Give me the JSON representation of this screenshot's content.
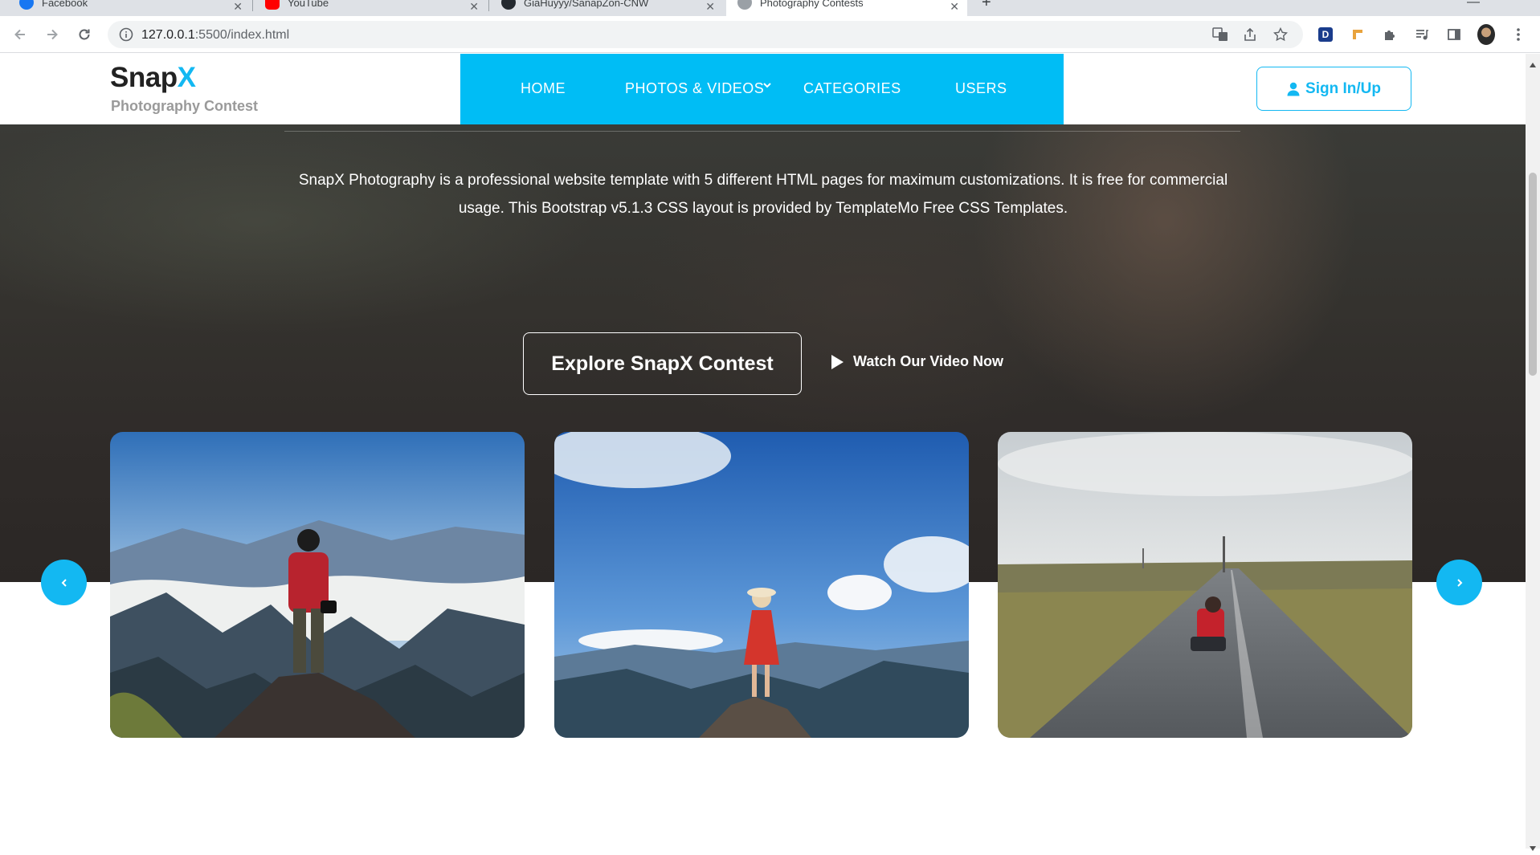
{
  "browser": {
    "tabs": [
      {
        "label": "Facebook",
        "active": false
      },
      {
        "label": "YouTube",
        "active": false
      },
      {
        "label": "GiaHuyyy/SanapZon-CNW",
        "active": false
      },
      {
        "label": "Photography Contests",
        "active": true
      }
    ],
    "url_host": "127.0.0.1",
    "url_rest": ":5500/index.html",
    "profile_badge": "D"
  },
  "site": {
    "logo_main": "Snap",
    "logo_accent": "X",
    "logo_sub": "Photography Contest",
    "nav": [
      "HOME",
      "PHOTOS & VIDEOS",
      "CATEGORIES",
      "USERS"
    ],
    "signin_label": "Sign In/Up",
    "accent_color": "#13b8f2",
    "nav_bg_color": "#00bdf5"
  },
  "hero": {
    "description": "SnapX Photography is a professional website template with 5 different HTML pages for maximum customizations. It is free for commercial usage. This Bootstrap v5.1.3 CSS layout is provided by TemplateMo Free CSS Templates.",
    "explore_label": "Explore SnapX Contest",
    "watch_label": "Watch Our Video Now"
  },
  "gallery": {
    "icons": [
      "chevron-left-icon",
      "chevron-right-icon"
    ]
  }
}
